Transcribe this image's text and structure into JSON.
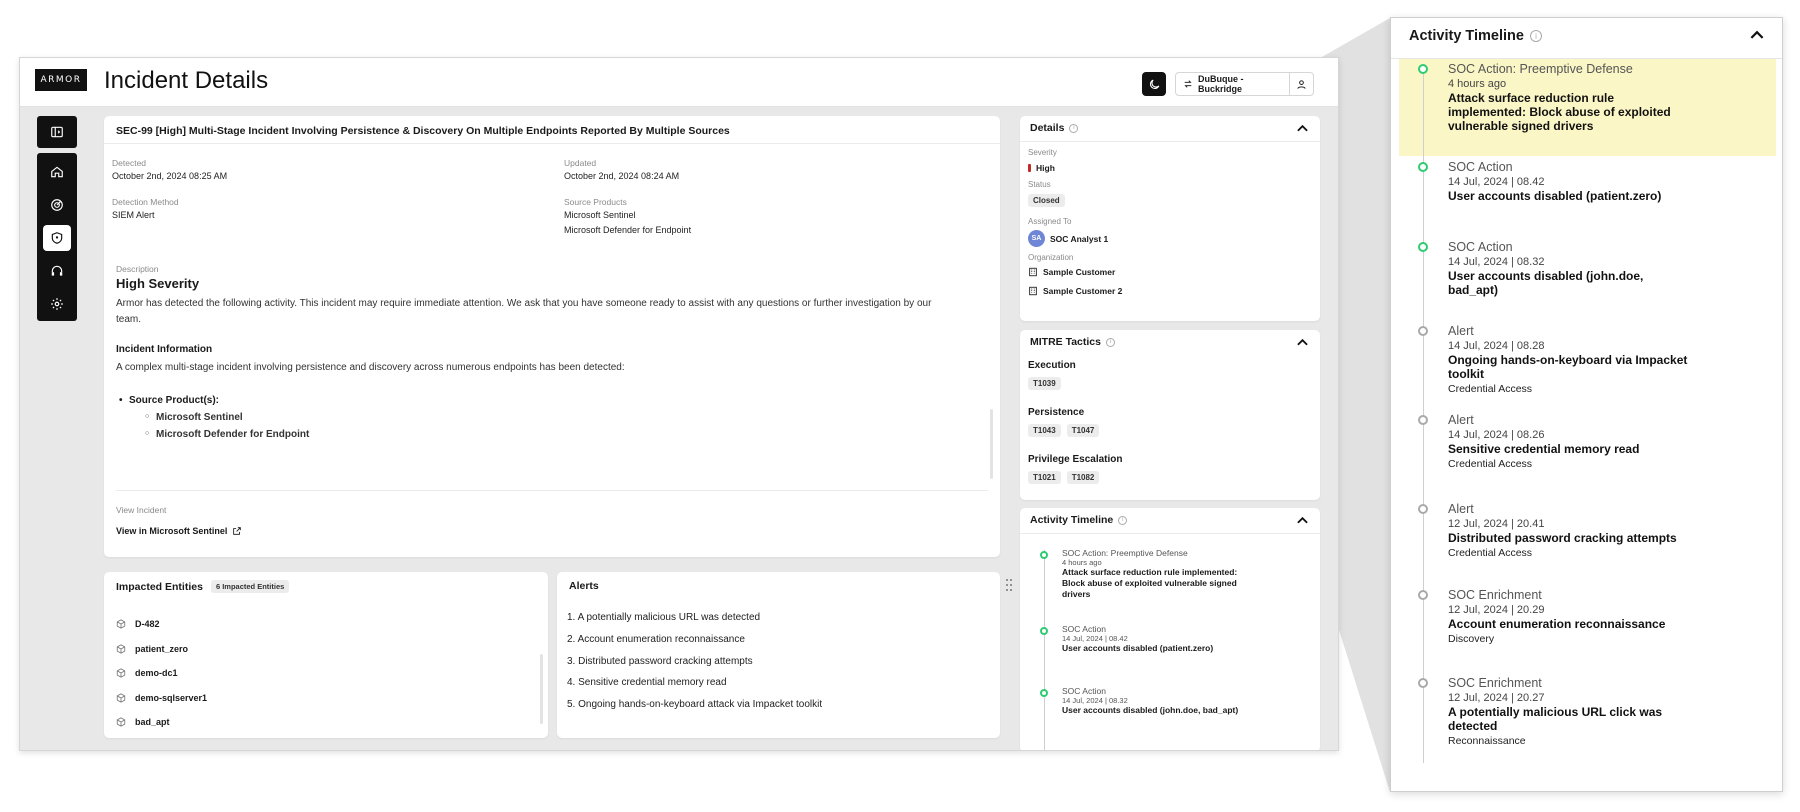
{
  "app": {
    "logo": "ARMOR",
    "page_title": "Incident Details",
    "org_switch_label": "DuBuque - Buckridge"
  },
  "incident": {
    "title": "SEC-99 [High] Multi-Stage Incident Involving Persistence & Discovery On Multiple Endpoints Reported By Multiple Sources",
    "detected_label": "Detected",
    "detected_value": "October 2nd, 2024 08:25 AM",
    "updated_label": "Updated",
    "updated_value": "October 2nd, 2024 08:24 AM",
    "method_label": "Detection Method",
    "method_value": "SIEM Alert",
    "products_label": "Source Products",
    "products": [
      "Microsoft Sentinel",
      "Microsoft Defender for Endpoint"
    ],
    "description_label": "Description",
    "description_heading": "High Severity",
    "description_text": "Armor has detected the following activity. This incident may require immediate attention. We ask that you have someone ready to assist with any questions or further investigation by our team.",
    "info_heading": "Incident Information",
    "info_text": "A complex multi-stage incident involving persistence and discovery across numerous endpoints has been detected:",
    "source_products_bullet": "Source Product(s):",
    "source_products_list": [
      "Microsoft Sentinel",
      "Microsoft Defender for Endpoint"
    ],
    "view_label": "View Incident",
    "view_link": "View in Microsoft Sentinel"
  },
  "details": {
    "title": "Details",
    "severity_label": "Severity",
    "severity_value": "High",
    "status_label": "Status",
    "status_value": "Closed",
    "assigned_label": "Assigned To",
    "assigned_initials": "SA",
    "assigned_value": "SOC Analyst 1",
    "org_label": "Organization",
    "orgs": [
      "Sample Customer",
      "Sample Customer 2"
    ]
  },
  "mitre": {
    "title": "MITRE Tactics",
    "tactics": [
      {
        "name": "Execution",
        "techniques": [
          "T1039"
        ]
      },
      {
        "name": "Persistence",
        "techniques": [
          "T1043",
          "T1047"
        ]
      },
      {
        "name": "Privilege Escalation",
        "techniques": [
          "T1021",
          "T1082"
        ]
      }
    ]
  },
  "timeline_small": {
    "title": "Activity Timeline",
    "events": [
      {
        "type": "SOC Action: Preemptive Defense",
        "time": "4 hours ago",
        "desc": "Attack surface reduction rule implemented: Block abuse of exploited vulnerable signed drivers"
      },
      {
        "type": "SOC Action",
        "time": "14 Jul, 2024 | 08.42",
        "desc": "User accounts disabled (patient.zero)"
      },
      {
        "type": "SOC Action",
        "time": "14 Jul, 2024 | 08.32",
        "desc": "User accounts disabled (john.doe, bad_apt)"
      }
    ]
  },
  "entities": {
    "title": "Impacted Entities",
    "count_badge": "6 Impacted Entities",
    "items": [
      "D-482",
      "patient_zero",
      "demo-dc1",
      "demo-sqlserver1",
      "bad_apt"
    ]
  },
  "alerts": {
    "title": "Alerts",
    "items": [
      "1. A potentially malicious URL was detected",
      "2. Account enumeration reconnaissance",
      "3. Distributed password cracking attempts",
      "4. Sensitive credential memory read",
      "5. Ongoing hands-on-keyboard attack via Impacket toolkit"
    ]
  },
  "timeline_zoom": {
    "title": "Activity Timeline",
    "events": [
      {
        "type": "SOC Action: Preemptive Defense",
        "time": "4 hours ago",
        "desc": "Attack surface reduction rule implemented: Block abuse of exploited vulnerable signed drivers",
        "category": "",
        "status": "green"
      },
      {
        "type": "SOC Action",
        "time": "14 Jul, 2024 | 08.42",
        "desc": "User accounts disabled (patient.zero)",
        "category": "",
        "status": "green"
      },
      {
        "type": "SOC Action",
        "time": "14 Jul, 2024 | 08.32",
        "desc": "User accounts disabled (john.doe, bad_apt)",
        "category": "",
        "status": "green"
      },
      {
        "type": "Alert",
        "time": "14 Jul, 2024 | 08.28",
        "desc": "Ongoing hands-on-keyboard via Impacket toolkit",
        "category": "Credential Access",
        "status": "grey"
      },
      {
        "type": "Alert",
        "time": "14 Jul, 2024 | 08.26",
        "desc": "Sensitive credential memory read",
        "category": "Credential Access",
        "status": "grey"
      },
      {
        "type": "Alert",
        "time": "12 Jul, 2024 | 20.41",
        "desc": "Distributed password cracking attempts",
        "category": "Credential Access",
        "status": "grey"
      },
      {
        "type": "SOC Enrichment",
        "time": "12 Jul, 2024 | 20.29",
        "desc": "Account enumeration reconnaissance",
        "category": "Discovery",
        "status": "grey"
      },
      {
        "type": "SOC Enrichment",
        "time": "12 Jul, 2024 | 20.27",
        "desc": "A potentially malicious URL click was detected",
        "category": "Reconnaissance",
        "status": "grey"
      }
    ]
  },
  "colors": {
    "accent_dark": "#111111",
    "severity_high": "#c62828",
    "timeline_green": "#2ecc71",
    "highlight": "#fbf6c6"
  }
}
